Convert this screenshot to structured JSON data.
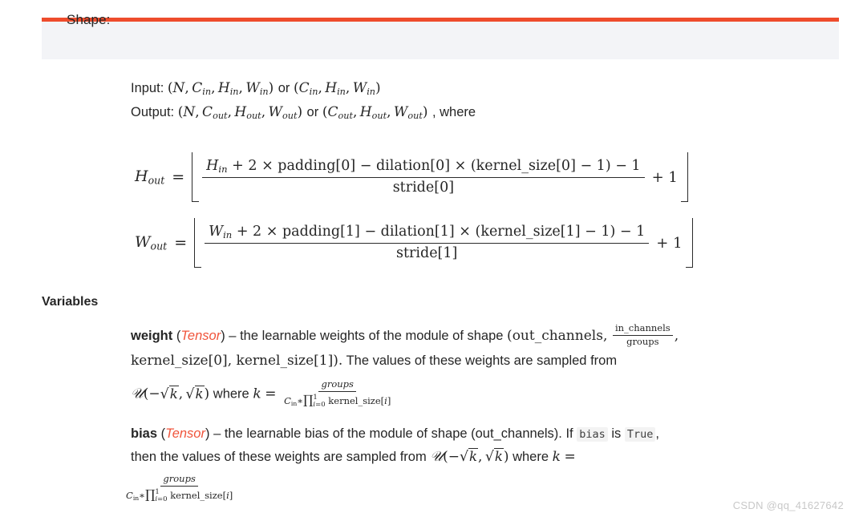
{
  "theme": {
    "accent_orange": "#ee4c2c",
    "panel_bg": "#f3f4f7",
    "tensor_red": "#f0543b",
    "code_bg": "#f3f3f3",
    "text": "#262626",
    "watermark_color": "#c8c8c8"
  },
  "shape_section": {
    "title": "Shape:",
    "input_label": "Input:",
    "input_tuple_1": "(N, C",
    "input_full": "Input: (N, C_in, H_in, W_in) or (C_in, H_in, W_in)",
    "output_full": "Output: (N, C_out, H_out, W_out) or (C_out, H_out, W_out), where",
    "output_label": "Output:",
    "where_word": ", where",
    "or_word": "or",
    "dims": {
      "N": "N",
      "C": "C",
      "H": "H",
      "W": "W",
      "sub_in": "in",
      "sub_out": "out"
    }
  },
  "equations": [
    {
      "id": "hout",
      "lhs": "H",
      "lhs_sub": "out",
      "equals": "=",
      "numerator": "H_in + 2 × padding[0] − dilation[0] × (kernel_size[0] − 1) − 1",
      "numerator_parts": {
        "var": "H",
        "var_sub": "in",
        "rest": "+ 2 × padding[0] − dilation[0] × (kernel_size[0] − 1) − 1"
      },
      "denominator": "stride[0]",
      "tail": "+ 1"
    },
    {
      "id": "wout",
      "lhs": "W",
      "lhs_sub": "out",
      "equals": "=",
      "numerator": "W_in + 2 × padding[1] − dilation[1] × (kernel_size[1] − 1) − 1",
      "numerator_parts": {
        "var": "W",
        "var_sub": "in",
        "rest": "+ 2 × padding[1] − dilation[1] × (kernel_size[1] − 1) − 1"
      },
      "denominator": "stride[1]",
      "tail": "+ 1"
    }
  ],
  "variables_section": {
    "heading": "Variables",
    "weight": {
      "name": "weight",
      "type": "Tensor",
      "open_paren": "(",
      "close_paren": ")",
      "dash": "–",
      "desc_part1": "the learnable weights of the module of shape",
      "shape_open": "(out_channels,",
      "frac_num": "in_channels",
      "frac_den": "groups",
      "comma": ",",
      "shape_rest": "kernel_size[0], kernel_size[1]).",
      "desc_part2": "The values of these weights are sampled from",
      "dist": {
        "cal": "ᵌ",
        "u_letter": "U",
        "open": "(−",
        "sqrt_k": "k",
        "mid": ",",
        "close": ")",
        "where": "where",
        "k_letter": "k",
        "equals": "=",
        "frac_num": "groups",
        "frac_den_c": "C",
        "frac_den_c_sub": "in",
        "frac_den_star": "*",
        "frac_den_prod": "∏",
        "frac_den_prod_sup": "1",
        "frac_den_prod_sub": "i=0",
        "frac_den_rest": "kernel_size[i]"
      }
    },
    "bias": {
      "name": "bias",
      "type": "Tensor",
      "open_paren": "(",
      "close_paren": ")",
      "dash": "–",
      "desc_part1": "the learnable bias of the module of shape (out_channels). If",
      "code_bias": "bias",
      "is_word": "is",
      "code_true": "True",
      "comma": ",",
      "desc_part2": "then the values of these weights are sampled from"
    }
  },
  "watermark": {
    "text": "CSDN @qq_41627642"
  }
}
